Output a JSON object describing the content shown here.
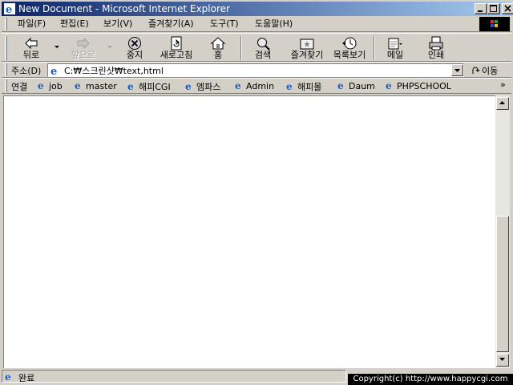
{
  "window": {
    "title": "New Document - Microsoft Internet Explorer"
  },
  "menu": {
    "items": [
      "파일(F)",
      "편집(E)",
      "보기(V)",
      "즐겨찾기(A)",
      "도구(T)",
      "도움말(H)"
    ]
  },
  "toolbar": {
    "back": "뒤로",
    "forward": "앞으로",
    "stop": "중지",
    "refresh": "새로고침",
    "home": "홈",
    "search": "검색",
    "favorites": "즐겨찾기",
    "history": "목록보기",
    "mail": "메일",
    "print": "인쇄"
  },
  "address": {
    "label": "주소(D)",
    "value": "C:₩스크린샷₩text,html",
    "go_label": "이동"
  },
  "links": {
    "label": "연결",
    "items": [
      "job",
      "master",
      "해피CGI",
      "엠파스",
      "Admin",
      "해피몰",
      "Daum",
      "PHPSCHOOL"
    ],
    "more": "»"
  },
  "status": {
    "text": "완료"
  },
  "overlay": {
    "copyright": "Copyright(c) http://www.happycgi.com"
  },
  "colors": {
    "titlebar_start": "#0a246a",
    "titlebar_end": "#a6caf0",
    "chrome": "#d4d0c8",
    "ie_blue": "#1c5fc8"
  }
}
